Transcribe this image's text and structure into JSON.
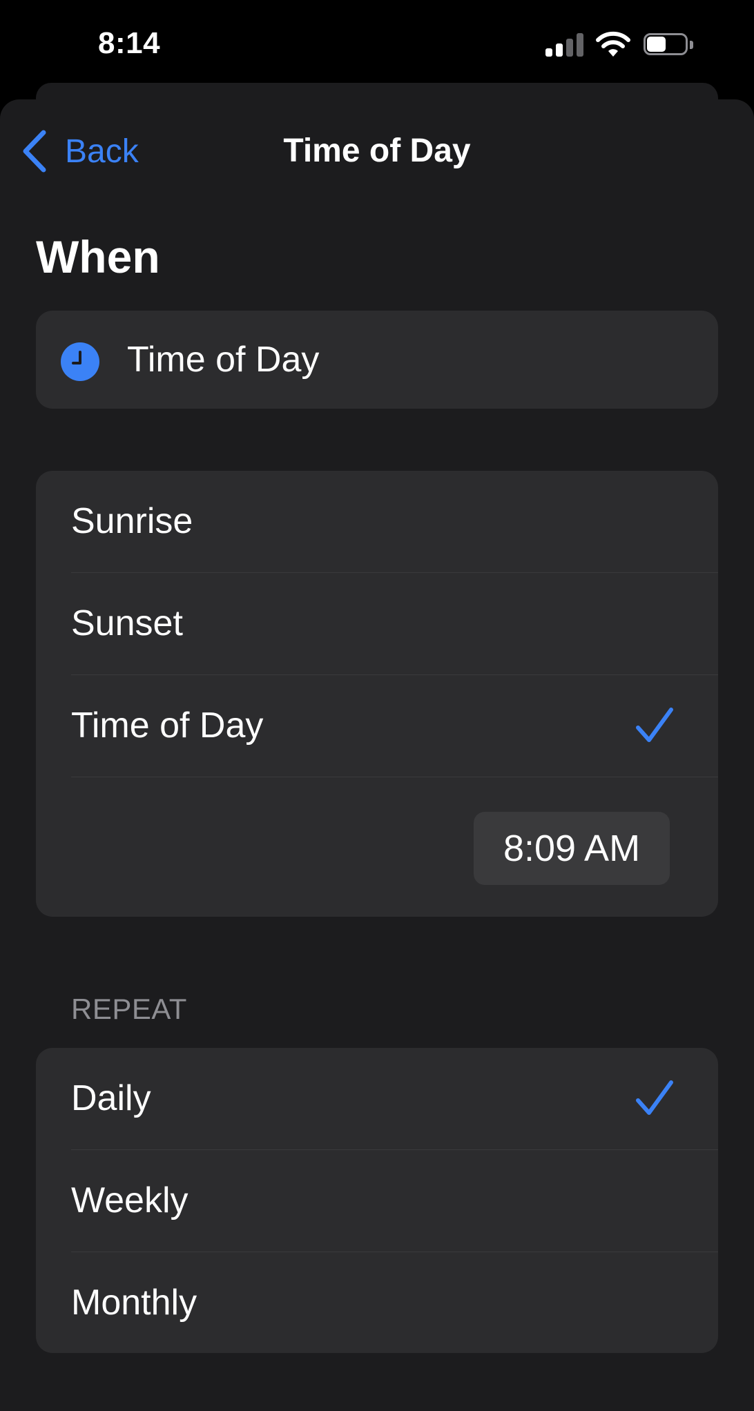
{
  "status_bar": {
    "time": "8:14",
    "icons": [
      "signal-icon",
      "wifi-icon",
      "battery-icon"
    ],
    "battery_level": 0.5,
    "signal_bars_active": 2
  },
  "nav": {
    "back_label": "Back",
    "title": "Time of Day"
  },
  "when": {
    "heading": "When",
    "trigger_label": "Time of Day",
    "trigger_icon": "clock-icon"
  },
  "options": [
    {
      "label": "Sunrise",
      "selected": false
    },
    {
      "label": "Sunset",
      "selected": false
    },
    {
      "label": "Time of Day",
      "selected": true
    }
  ],
  "time_value": "8:09 AM",
  "repeat": {
    "header": "REPEAT",
    "items": [
      {
        "label": "Daily",
        "selected": true
      },
      {
        "label": "Weekly",
        "selected": false
      },
      {
        "label": "Monthly",
        "selected": false
      }
    ]
  },
  "colors": {
    "accent": "#3b82f6",
    "background": "#1c1c1e",
    "card": "#2c2c2e",
    "secondary_text": "#8e8e93"
  }
}
